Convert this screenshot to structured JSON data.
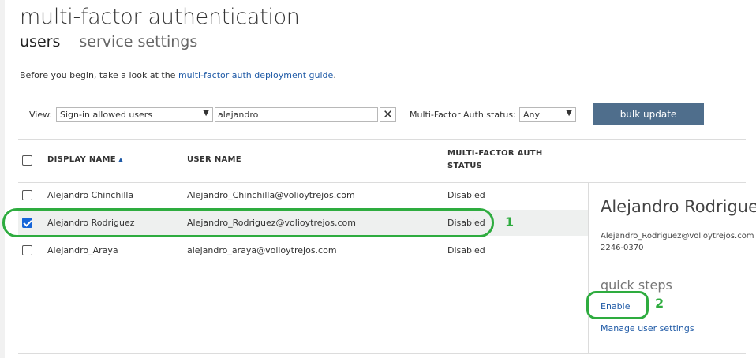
{
  "header": {
    "title": "multi-factor authentication",
    "tabs": [
      {
        "label": "users",
        "active": true
      },
      {
        "label": "service settings",
        "active": false
      }
    ]
  },
  "intro": {
    "prefix": "Before you begin, take a look at the ",
    "link": "multi-factor auth deployment guide",
    "suffix": "."
  },
  "filters": {
    "view_label": "View:",
    "view_value": "Sign-in allowed users",
    "search_value": "alejandro",
    "clear_label": "✕",
    "mfa_status_label": "Multi-Factor Auth status:",
    "mfa_status_value": "Any",
    "bulk_update_label": "bulk update"
  },
  "table": {
    "headers": {
      "display_name": "DISPLAY NAME",
      "user_name": "USER NAME",
      "mfa_status_line1": "MULTI-FACTOR AUTH",
      "mfa_status_line2": "STATUS"
    },
    "rows": [
      {
        "display_name": "Alejandro Chinchilla",
        "user_name": "Alejandro_Chinchilla@volioytrejos.com",
        "status": "Disabled",
        "checked": false
      },
      {
        "display_name": "Alejandro Rodriguez",
        "user_name": "Alejandro_Rodriguez@volioytrejos.com",
        "status": "Disabled",
        "checked": true
      },
      {
        "display_name": "Alejandro_Araya",
        "user_name": "alejandro_araya@volioytrejos.com",
        "status": "Disabled",
        "checked": false
      }
    ]
  },
  "detail": {
    "name": "Alejandro Rodriguez",
    "email": "Alejandro_Rodriguez@volioytrejos.com",
    "phone": "2246-0370",
    "quick_steps_label": "quick steps",
    "enable_link": "Enable",
    "manage_link": "Manage user settings"
  },
  "annotations": {
    "step1": "1",
    "step2": "2",
    "color": "#2eac3f"
  },
  "colors": {
    "accent_button": "#4f6e8c",
    "link": "#1f5aa6",
    "checkbox_checked": "#1565d8"
  }
}
